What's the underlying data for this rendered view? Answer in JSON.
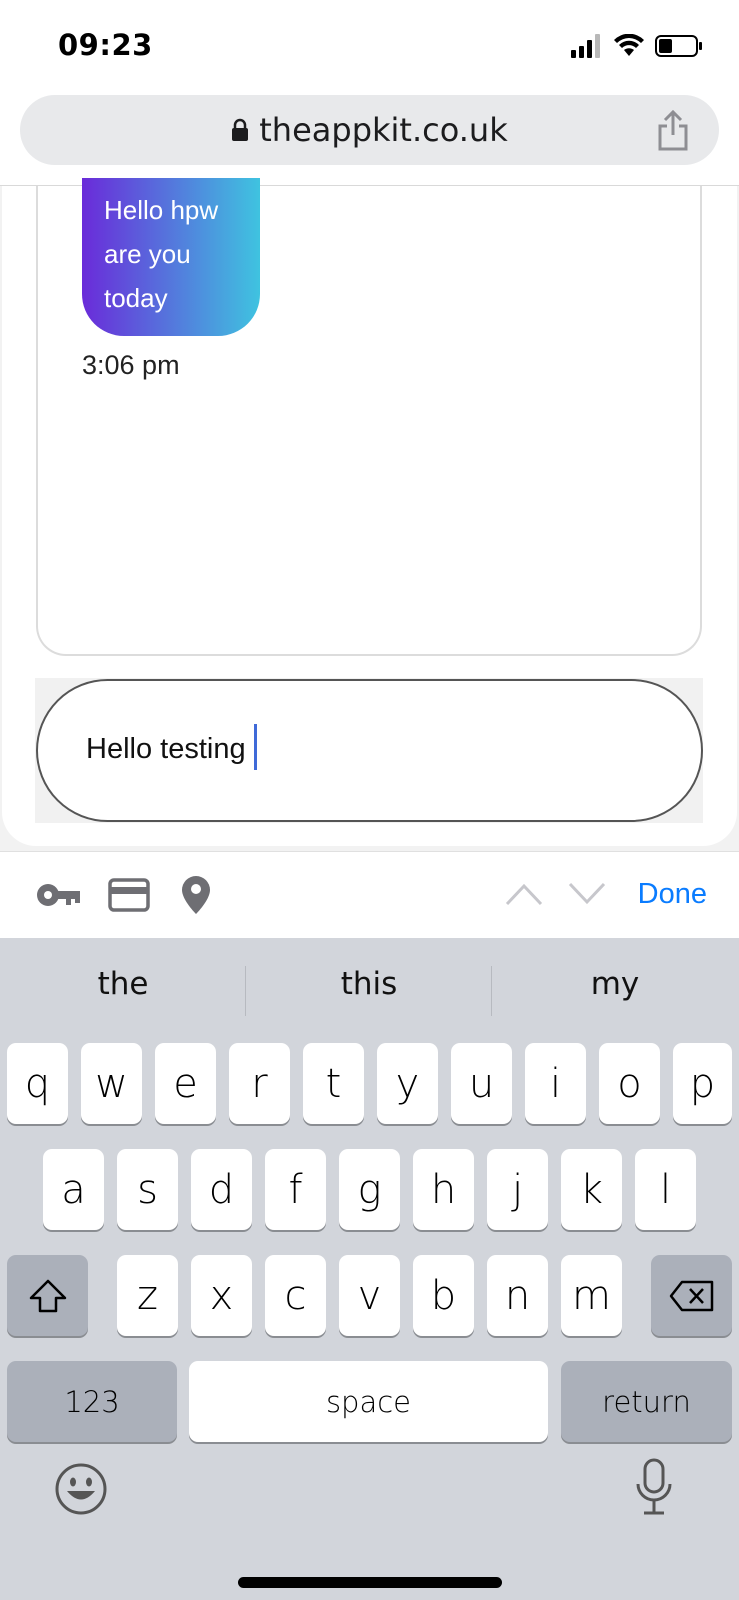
{
  "status_bar": {
    "time": "09:23"
  },
  "browser": {
    "url": "theappkit.co.uk"
  },
  "chat": {
    "messages": [
      {
        "line1": "Hello hpw",
        "line2": "are you",
        "line3": "today",
        "time": "3:06 pm"
      }
    ],
    "input_value": "Hello testing"
  },
  "accessory_bar": {
    "done_label": "Done"
  },
  "keyboard": {
    "suggestions": [
      "the",
      "this",
      "my"
    ],
    "row1": [
      "q",
      "w",
      "e",
      "r",
      "t",
      "y",
      "u",
      "i",
      "o",
      "p"
    ],
    "row2": [
      "a",
      "s",
      "d",
      "f",
      "g",
      "h",
      "j",
      "k",
      "l"
    ],
    "row3": [
      "z",
      "x",
      "c",
      "v",
      "b",
      "n",
      "m"
    ],
    "numbers_label": "123",
    "space_label": "space",
    "return_label": "return"
  },
  "colors": {
    "accent": "#0a7cff",
    "bubble_gradient_start": "#6a2bd9",
    "bubble_gradient_end": "#3fc3e0",
    "keyboard_bg": "#d2d5db"
  }
}
